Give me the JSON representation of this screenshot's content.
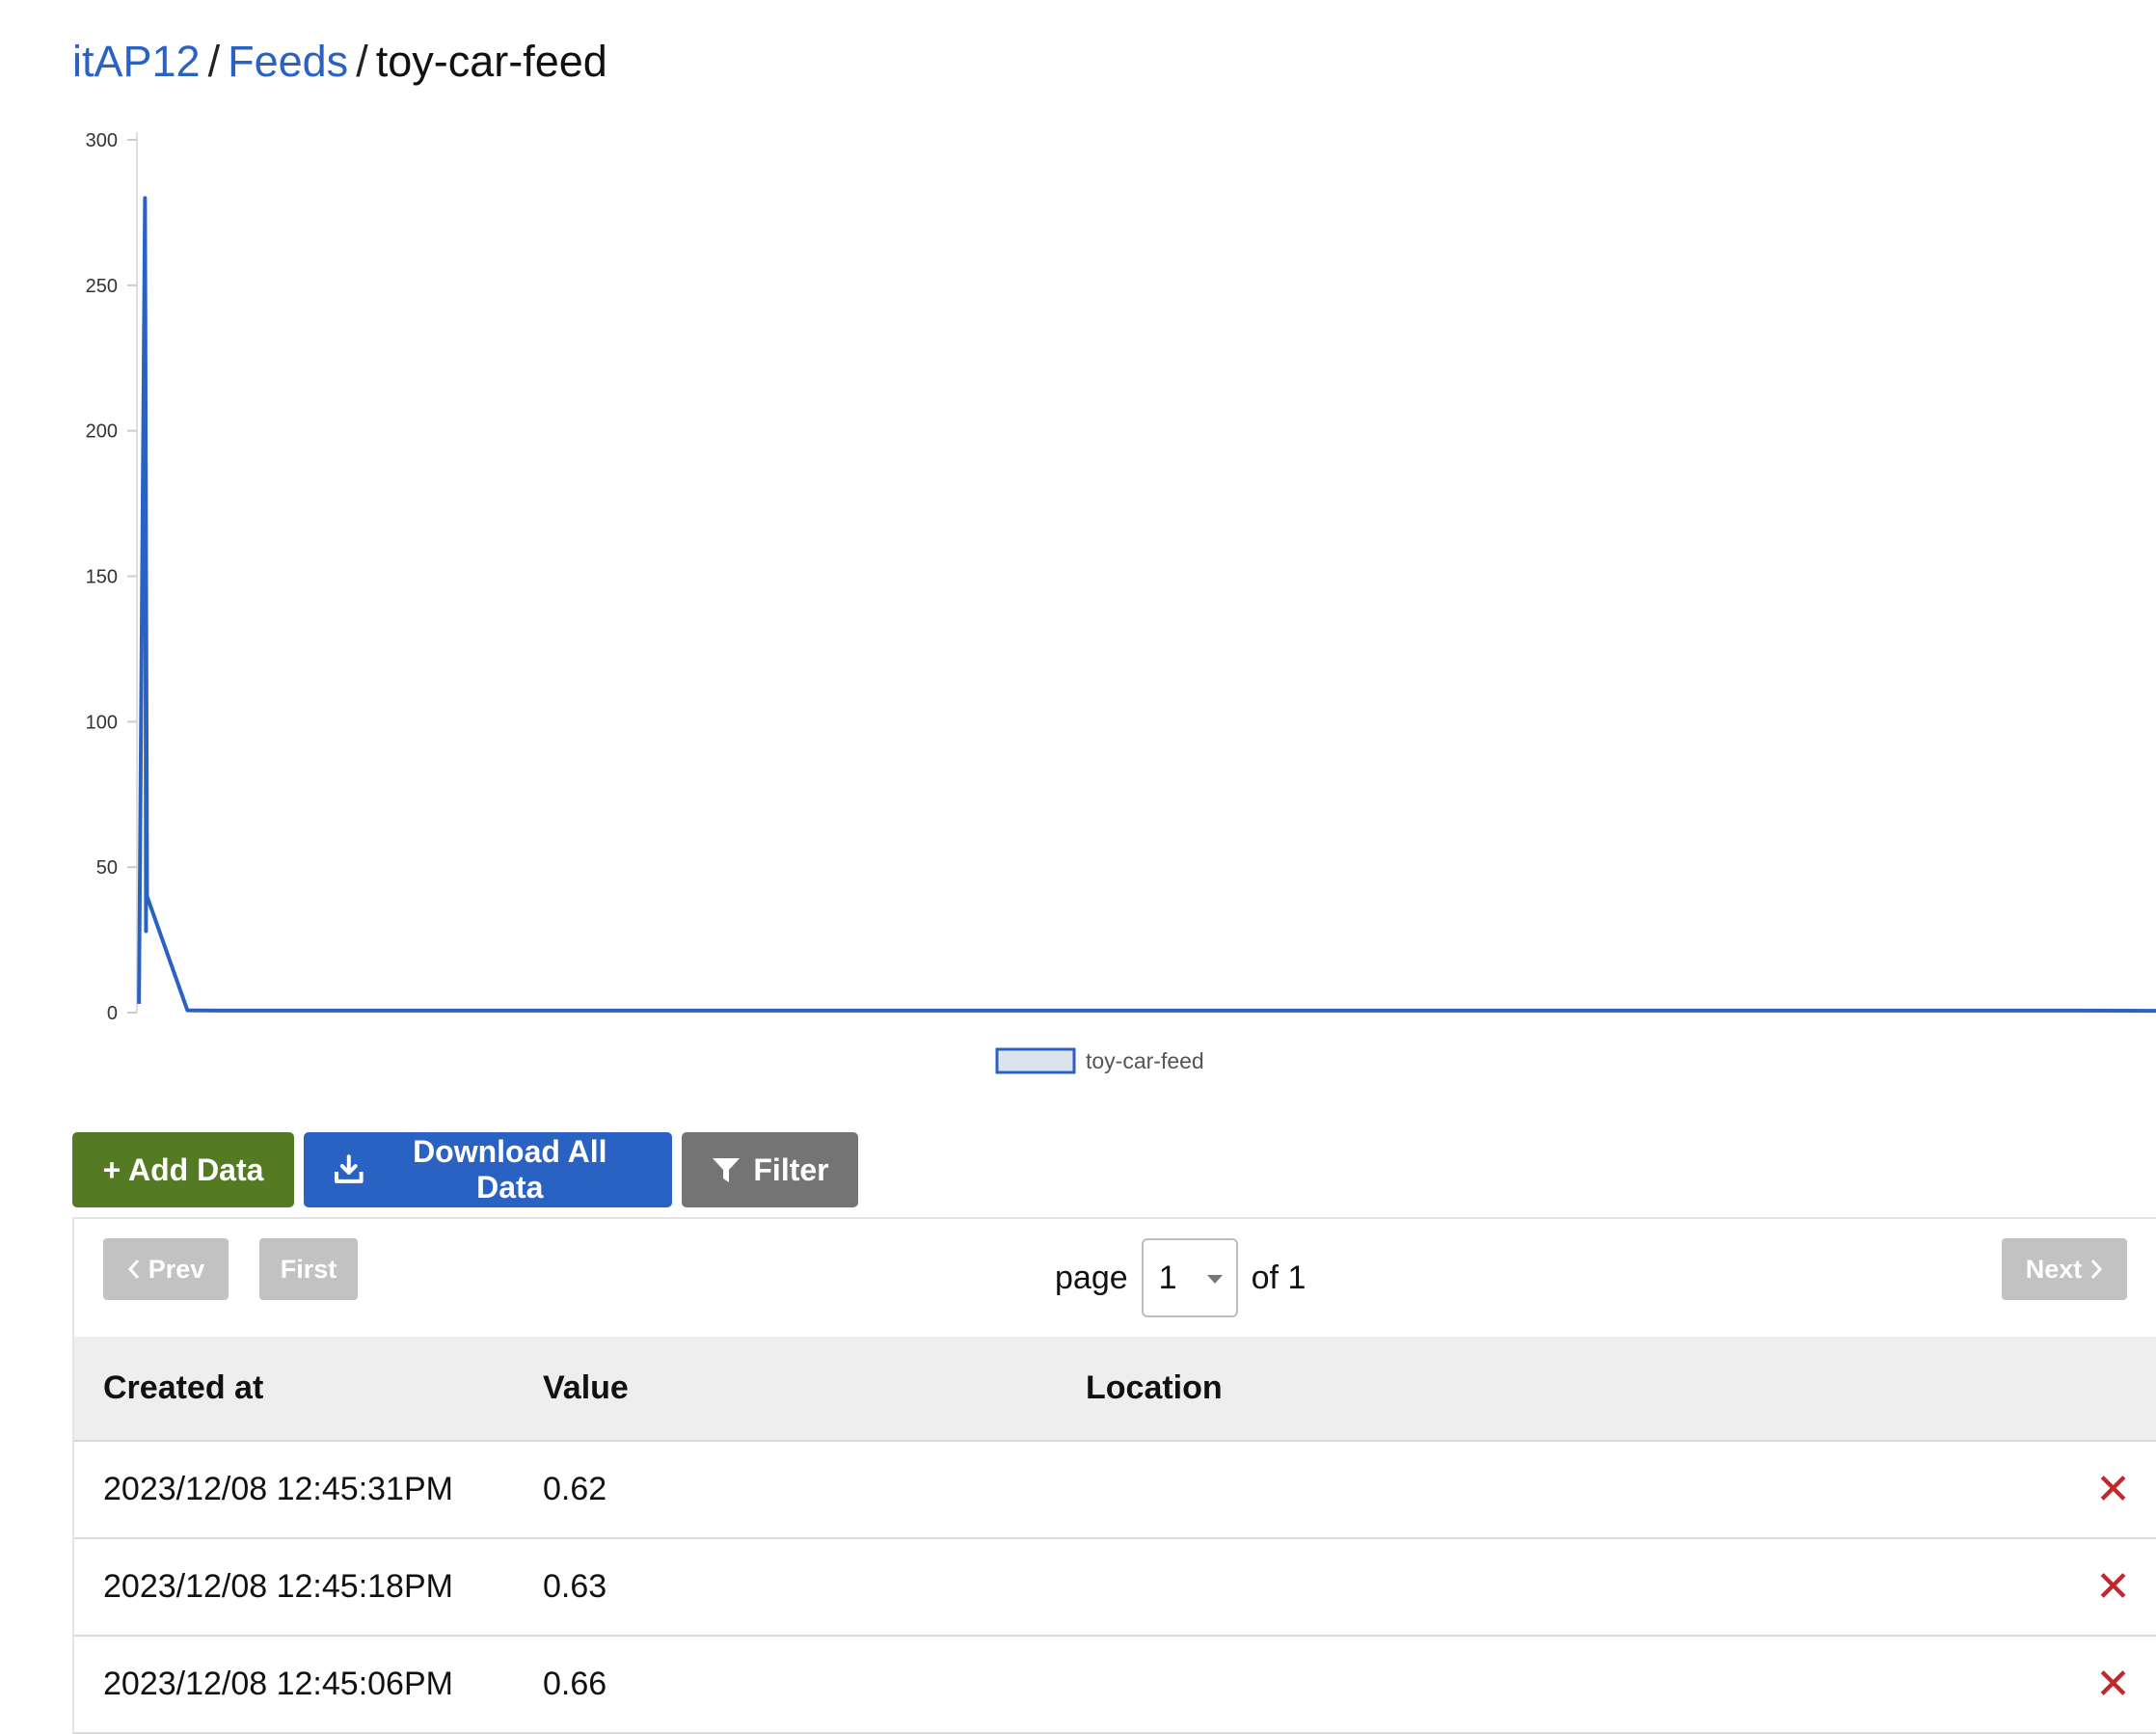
{
  "breadcrumb": {
    "account": "itAP12",
    "separator": "/",
    "feeds": "Feeds",
    "feed": "toy-car-feed"
  },
  "chart_data": {
    "type": "line",
    "title": "",
    "xlabel": "",
    "ylabel": "",
    "ylim": [
      0,
      300
    ],
    "yticks": [
      "0",
      "50",
      "100",
      "150",
      "200",
      "250",
      "300"
    ],
    "grid": false,
    "legend_position": "bottom-center",
    "line_color": "#2a62c4",
    "legend_fill": "#dde3ec",
    "series": [
      {
        "name": "toy-car-feed",
        "values": [
          3,
          280,
          28,
          280,
          40,
          0.8,
          0.7,
          0.7,
          0.7,
          0.7,
          0.7,
          0.7,
          0.66,
          0.63,
          0.62
        ]
      }
    ]
  },
  "actions": {
    "add": "+ Add Data",
    "download": "Download All Data",
    "filter": "Filter",
    "download_icon": "download-icon",
    "filter_icon": "funnel-icon"
  },
  "pager": {
    "prev": "Prev",
    "first": "First",
    "next": "Next",
    "page_label": "page",
    "page_value": "1",
    "of_label": "of 1"
  },
  "table": {
    "columns": [
      "Created at",
      "Value",
      "Location"
    ],
    "rows": [
      {
        "created_at": "2023/12/08 12:45:31PM",
        "value": "0.62",
        "location": "",
        "delete": "✕"
      },
      {
        "created_at": "2023/12/08 12:45:18PM",
        "value": "0.63",
        "location": "",
        "delete": "✕"
      },
      {
        "created_at": "2023/12/08 12:45:06PM",
        "value": "0.66",
        "location": "",
        "delete": "✕"
      }
    ]
  },
  "colors": {
    "link": "#2a62c4",
    "add_button": "#557a24",
    "download_button": "#2a62c4",
    "filter_button": "#747474",
    "pager_button": "#c2c2c2",
    "delete": "#c0282d"
  }
}
